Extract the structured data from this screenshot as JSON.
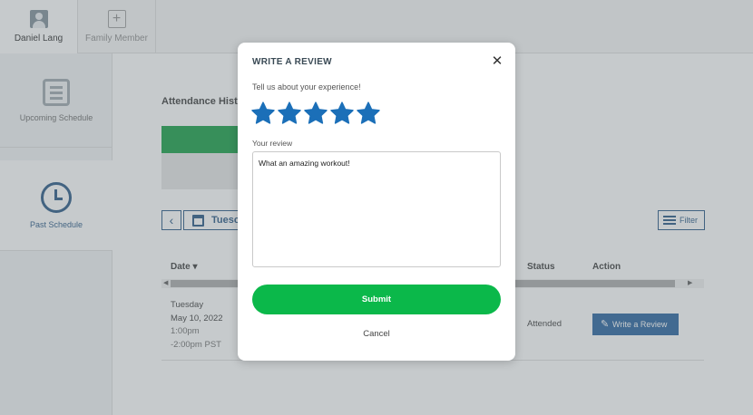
{
  "profiles": {
    "active_name": "Daniel Lang",
    "add_label": "Family Member"
  },
  "sidebar": {
    "items": [
      {
        "label": "Upcoming Schedule",
        "icon": "document-icon"
      },
      {
        "label": "Past Schedule",
        "icon": "clock-icon"
      }
    ]
  },
  "main": {
    "attendance_title": "Attendance Histo",
    "date_picker_label": "Tuesc",
    "filter_label": "Filter",
    "columns": {
      "date": "Date ▾",
      "status": "Status",
      "action": "Action"
    },
    "row": {
      "day": "Tuesday",
      "date": "May 10, 2022",
      "time_start": "1:00pm",
      "time_end": "-2:00pm PST",
      "status": "Attended",
      "action_label": "Write a Review"
    }
  },
  "modal": {
    "title": "WRITE A REVIEW",
    "prompt": "Tell us about your experience!",
    "rating": 5,
    "rating_max": 5,
    "review_label": "Your review",
    "review_value": "What an amazing workout!",
    "submit_label": "Submit",
    "cancel_label": "Cancel"
  },
  "colors": {
    "brand_blue": "#1d5a99",
    "star_blue": "#1b6fb8",
    "submit_green": "#0bb84a",
    "progress_green": "#0a9a3c"
  }
}
